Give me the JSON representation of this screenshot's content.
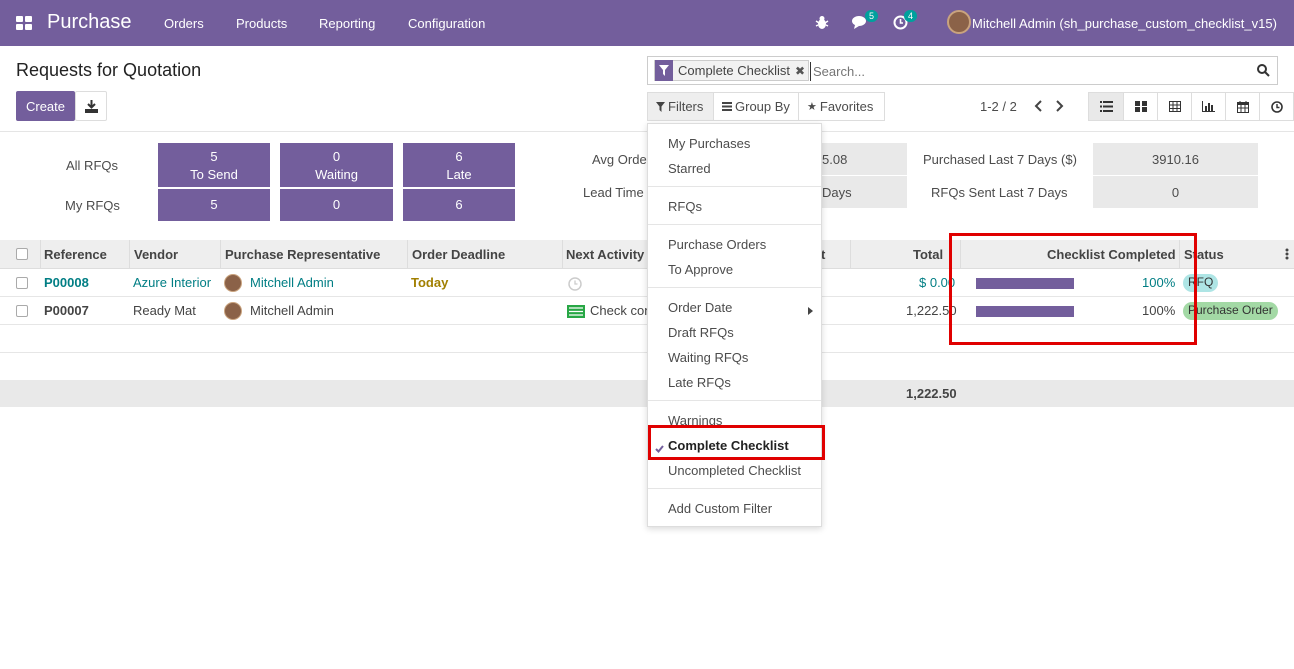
{
  "nav": {
    "brand": "Purchase",
    "menu": [
      "Orders",
      "Products",
      "Reporting",
      "Configuration"
    ],
    "messages_count": "5",
    "activities_count": "4",
    "user": "Mitchell Admin (sh_purchase_custom_checklist_v15)"
  },
  "page": {
    "title": "Requests for Quotation",
    "create_label": "Create"
  },
  "search": {
    "facet": "Complete Checklist",
    "placeholder": "Search...",
    "filters_label": "Filters",
    "groupby_label": "Group By",
    "favorites_label": "Favorites",
    "pager": "1-2 / 2"
  },
  "dashboard": {
    "all_rfqs_label": "All RFQs",
    "my_rfqs_label": "My RFQs",
    "tiles": [
      {
        "value": "5",
        "label": "To Send"
      },
      {
        "value": "0",
        "label": "Waiting"
      },
      {
        "value": "6",
        "label": "Late"
      }
    ],
    "my_values": [
      "5",
      "0",
      "6"
    ],
    "avg_order_label": "Avg Orde",
    "avg_order_value": "5.08",
    "lead_time_label": "Lead Time",
    "lead_time_value": "Days",
    "purchased_7_label": "Purchased Last 7 Days ($)",
    "purchased_7_value": "3910.16",
    "rfqs_sent_label": "RFQs Sent Last 7 Days",
    "rfqs_sent_value": "0"
  },
  "table": {
    "headers": [
      "Reference",
      "Vendor",
      "Purchase Representative",
      "Order Deadline",
      "Next Activity",
      "t",
      "Total",
      "Checklist Completed",
      "Status"
    ],
    "rows": [
      {
        "reference": "P00008",
        "vendor": "Azure Interior",
        "rep": "Mitchell Admin",
        "deadline": "Today",
        "activity": "",
        "total": "$ 0.00",
        "checklist": 100,
        "checklist_label": "100%",
        "status": "RFQ",
        "status_color": "#aee5e5"
      },
      {
        "reference": "P00007",
        "vendor": "Ready Mat",
        "rep": "Mitchell Admin",
        "deadline": "",
        "activity": "Check con",
        "total": "1,222.50",
        "checklist": 100,
        "checklist_label": "100%",
        "status": "Purchase Order",
        "status_color": "#a3d9a5"
      }
    ],
    "grand_total": "1,222.50"
  },
  "filters_menu": {
    "items": [
      "My Purchases",
      "Starred",
      "RFQs",
      "Purchase Orders",
      "To Approve",
      "Order Date",
      "Draft RFQs",
      "Waiting RFQs",
      "Late RFQs",
      "Warnings",
      "Complete Checklist",
      "Uncompleted Checklist",
      "Add Custom Filter"
    ]
  },
  "colors": {
    "brand": "#735e9c",
    "highlight": "#e00000",
    "link": "#017e84"
  }
}
